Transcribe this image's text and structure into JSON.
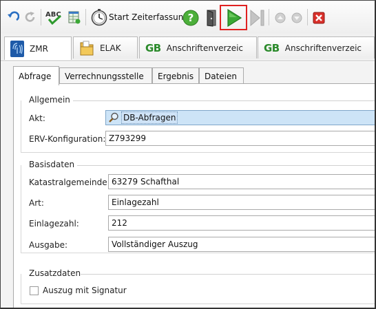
{
  "toolbar": {
    "start_time_tracking_label": "Start Zeiterfassung"
  },
  "module_tabs": [
    {
      "label": "ZMR"
    },
    {
      "label": "ELAK"
    },
    {
      "prefix": "GB",
      "label": "Anschriftenverzeic"
    },
    {
      "prefix": "GB",
      "label": "Anschriftenverzeic"
    }
  ],
  "sub_tabs": [
    {
      "label": "Abfrage"
    },
    {
      "label": "Verrechnungsstelle"
    },
    {
      "label": "Ergebnis"
    },
    {
      "label": "Dateien"
    }
  ],
  "allgemein": {
    "title": "Allgemein",
    "akt_label": "Akt:",
    "akt_value": "DB-Abfragen",
    "erv_label": "ERV-Konfiguration:",
    "erv_value": "Z793299"
  },
  "basisdaten": {
    "title": "Basisdaten",
    "kg_label": "Katastralgemeinde:",
    "kg_value": "63279 Schafthal",
    "art_label": "Art:",
    "art_value": "Einlagezahl",
    "ez_label": "Einlagezahl:",
    "ez_value": "212",
    "ausgabe_label": "Ausgabe:",
    "ausgabe_value": "Vollständiger Auszug"
  },
  "zusatzdaten": {
    "title": "Zusatzdaten",
    "signatur_label": "Auszug mit Signatur",
    "signatur_checked": false
  },
  "colors": {
    "play_green": "#3aa835",
    "highlight_red": "#e02020",
    "help_green": "#4caf3a",
    "close_red": "#d9302a"
  }
}
